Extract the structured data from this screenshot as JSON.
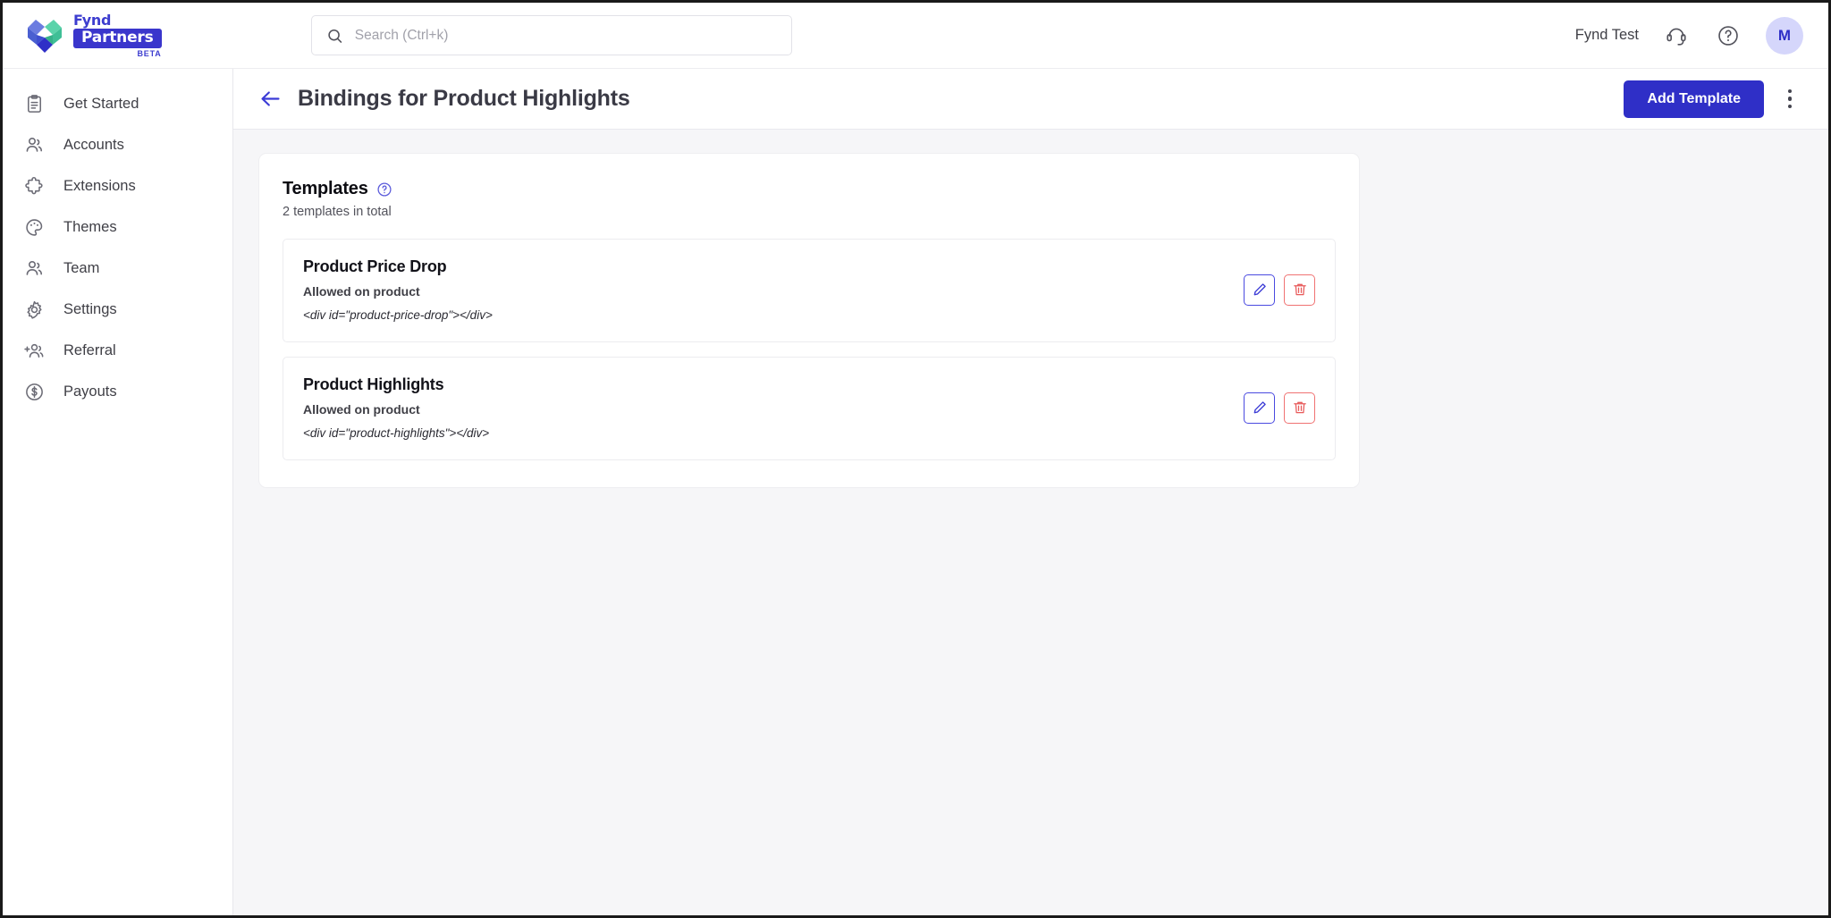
{
  "brand": {
    "fynd": "Fynd",
    "partners": "Partners",
    "beta": "BETA",
    "logo_blue": "#4a5fd1",
    "logo_green": "#45c8a0",
    "logo_indigo": "#3a36cc"
  },
  "search": {
    "placeholder": "Search (Ctrl+k)",
    "value": "",
    "icon": "search-icon"
  },
  "topbar": {
    "org_name": "Fynd Test",
    "support_icon": "headset-support-icon",
    "help_icon": "help-circle-icon",
    "avatar_initial": "M",
    "avatar_bg": "#d5d6fb",
    "avatar_fg": "#2f2fc7"
  },
  "sidebar": {
    "items": [
      {
        "label": "Get Started",
        "icon": "clipboard-icon"
      },
      {
        "label": "Accounts",
        "icon": "people-icon"
      },
      {
        "label": "Extensions",
        "icon": "puzzle-piece-icon"
      },
      {
        "label": "Themes",
        "icon": "palette-icon"
      },
      {
        "label": "Team",
        "icon": "people-icon"
      },
      {
        "label": "Settings",
        "icon": "gear-icon"
      },
      {
        "label": "Referral",
        "icon": "person-add-icon"
      },
      {
        "label": "Payouts",
        "icon": "dollar-circle-icon"
      }
    ]
  },
  "page": {
    "back_icon": "arrow-left-icon",
    "title": "Bindings for Product Highlights",
    "add_template_label": "Add Template",
    "primary_color": "#2f2fc7",
    "kebab_icon": "more-vertical-icon"
  },
  "panel": {
    "title": "Templates",
    "help_icon": "help-circle-icon",
    "subtitle": "2 templates in total",
    "templates": [
      {
        "name": "Product Price Drop",
        "allowed_on": "Allowed on product",
        "code": "<div id=\"product-price-drop\"></div>",
        "edit_icon": "pencil-icon",
        "delete_icon": "trash-icon"
      },
      {
        "name": "Product Highlights",
        "allowed_on": "Allowed on product",
        "code": "<div id=\"product-highlights\"></div>",
        "edit_icon": "pencil-icon",
        "delete_icon": "trash-icon"
      }
    ]
  }
}
